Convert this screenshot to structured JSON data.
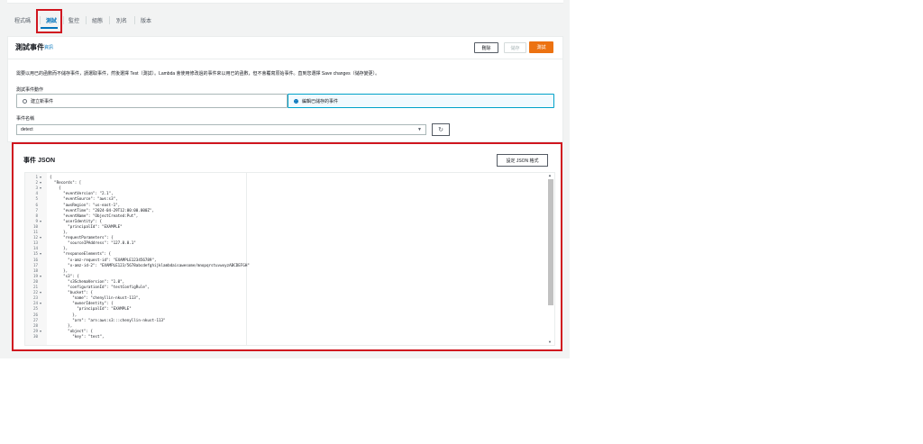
{
  "tabs": [
    {
      "label": "程式碼"
    },
    {
      "label": "測試"
    },
    {
      "label": "監控"
    },
    {
      "label": "組態"
    },
    {
      "label": "別名"
    },
    {
      "label": "版本"
    }
  ],
  "active_tab": "測試",
  "card": {
    "title": "測試事件",
    "info_link": "資訊",
    "buttons": {
      "delete": "刪除",
      "save": "儲存",
      "test": "測試"
    },
    "description": "需要以用已的函數而不儲存事件，請選取事件，然後選擇 Test（測試）。Lambda 會使用修改過的事件來以用已的函數，但不會覆寫原始事件。直到您選擇 Save changes（儲存變更）。",
    "action_label": "測試事件動作",
    "option_new": "建立新事件",
    "option_edit": "編輯已儲存的事件",
    "name_label": "事件名稱",
    "name_value": "detect"
  },
  "json_section": {
    "title": "事件 JSON",
    "format_button": "設定 JSON 格式"
  },
  "code_lines": [
    {
      "n": "1",
      "f": "▾",
      "t": "{"
    },
    {
      "n": "2",
      "f": "▾",
      "t": "  \"Records\": ["
    },
    {
      "n": "3",
      "f": "▾",
      "t": "    {"
    },
    {
      "n": "4",
      "f": "",
      "t": "      \"eventVersion\": \"2.1\","
    },
    {
      "n": "5",
      "f": "",
      "t": "      \"eventSource\": \"aws:s3\","
    },
    {
      "n": "6",
      "f": "",
      "t": "      \"awsRegion\": \"us-east-1\","
    },
    {
      "n": "7",
      "f": "",
      "t": "      \"eventTime\": \"2024-04-29T12:00:00.000Z\","
    },
    {
      "n": "8",
      "f": "",
      "t": "      \"eventName\": \"ObjectCreated:Put\","
    },
    {
      "n": "9",
      "f": "▾",
      "t": "      \"userIdentity\": {"
    },
    {
      "n": "10",
      "f": "",
      "t": "        \"principalId\": \"EXAMPLE\""
    },
    {
      "n": "11",
      "f": "",
      "t": "      },"
    },
    {
      "n": "12",
      "f": "▾",
      "t": "      \"requestParameters\": {"
    },
    {
      "n": "13",
      "f": "",
      "t": "        \"sourceIPAddress\": \"127.0.0.1\""
    },
    {
      "n": "14",
      "f": "",
      "t": "      },"
    },
    {
      "n": "15",
      "f": "▾",
      "t": "      \"responseElements\": {"
    },
    {
      "n": "16",
      "f": "",
      "t": "        \"x-amz-request-id\": \"EXAMPLE123456789\","
    },
    {
      "n": "17",
      "f": "",
      "t": "        \"x-amz-id-2\": \"EXAMPLE123/5678abcdefghijklambdaisawesome/mnopqrstuvwxyzABCDEFGH\""
    },
    {
      "n": "18",
      "f": "",
      "t": "      },"
    },
    {
      "n": "19",
      "f": "▾",
      "t": "      \"s3\": {"
    },
    {
      "n": "20",
      "f": "",
      "t": "        \"s3SchemaVersion\": \"1.0\","
    },
    {
      "n": "21",
      "f": "",
      "t": "        \"configurationId\": \"testConfigRule\","
    },
    {
      "n": "22",
      "f": "▾",
      "t": "        \"bucket\": {"
    },
    {
      "n": "23",
      "f": "",
      "t": "          \"name\": \"chenyllin-nkust-113\","
    },
    {
      "n": "24",
      "f": "▾",
      "t": "          \"ownerIdentity\": {"
    },
    {
      "n": "25",
      "f": "",
      "t": "            \"principalId\": \"EXAMPLE\""
    },
    {
      "n": "26",
      "f": "",
      "t": "          },"
    },
    {
      "n": "27",
      "f": "",
      "t": "          \"arn\": \"arn:aws:s3:::chenyllin-nkust-113\""
    },
    {
      "n": "28",
      "f": "",
      "t": "        },"
    },
    {
      "n": "29",
      "f": "▾",
      "t": "        \"object\": {"
    },
    {
      "n": "30",
      "f": "",
      "t": "          \"key\": \"test\","
    }
  ]
}
